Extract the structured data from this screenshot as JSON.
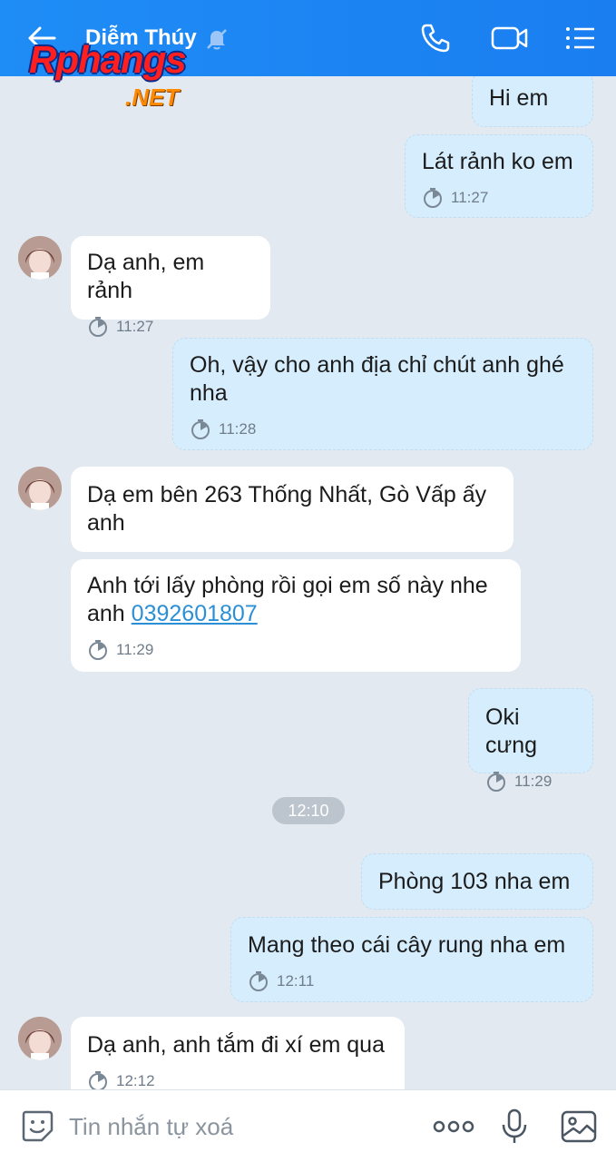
{
  "header": {
    "contact_name": "Diễm Thúy",
    "back_icon": "arrow-left-icon",
    "mute_icon": "bell-off-icon",
    "call_icon": "phone-icon",
    "video_icon": "video-camera-icon",
    "menu_icon": "list-menu-icon",
    "background_color": "#1f8df6"
  },
  "watermark": {
    "main": "Rphangs",
    "sub": ".NET"
  },
  "messages": [
    {
      "direction": "out",
      "text": "Hi em",
      "time": ""
    },
    {
      "direction": "out",
      "text": "Lát rảnh ko em",
      "time": "11:27"
    },
    {
      "direction": "in",
      "text": "Dạ anh, em rảnh",
      "time": "11:27"
    },
    {
      "direction": "out",
      "text": "Oh, vậy cho anh địa chỉ chút anh ghé nha",
      "time": "11:28"
    },
    {
      "direction": "in",
      "text": "Dạ em bên 263 Thống Nhất, Gò Vấp ấy anh",
      "time": ""
    },
    {
      "direction": "in",
      "text": "Anh tới lấy phòng rồi gọi em số này nhe anh",
      "phone": "0392601807",
      "time": "11:29"
    },
    {
      "direction": "out",
      "text": "Oki cưng",
      "time": "11:29"
    },
    {
      "direction": "out",
      "text": "Phòng 103 nha em",
      "time": ""
    },
    {
      "direction": "out",
      "text": "Mang theo cái cây rung nha em",
      "time": "12:11"
    },
    {
      "direction": "in",
      "text": "Dạ anh, anh tắm đi xí em qua",
      "time": "12:12"
    }
  ],
  "separator_time": "12:10",
  "input_bar": {
    "placeholder": "Tin nhắn tự xoá",
    "emoji_icon": "emoji-sticker-icon",
    "more_icon": "more-dots-icon",
    "mic_icon": "microphone-icon",
    "image_icon": "image-gallery-icon"
  },
  "colors": {
    "outgoing_bubble": "#d5edfd",
    "incoming_bubble": "#ffffff",
    "chat_background": "#e2e9f1",
    "link": "#2b8fd6"
  }
}
